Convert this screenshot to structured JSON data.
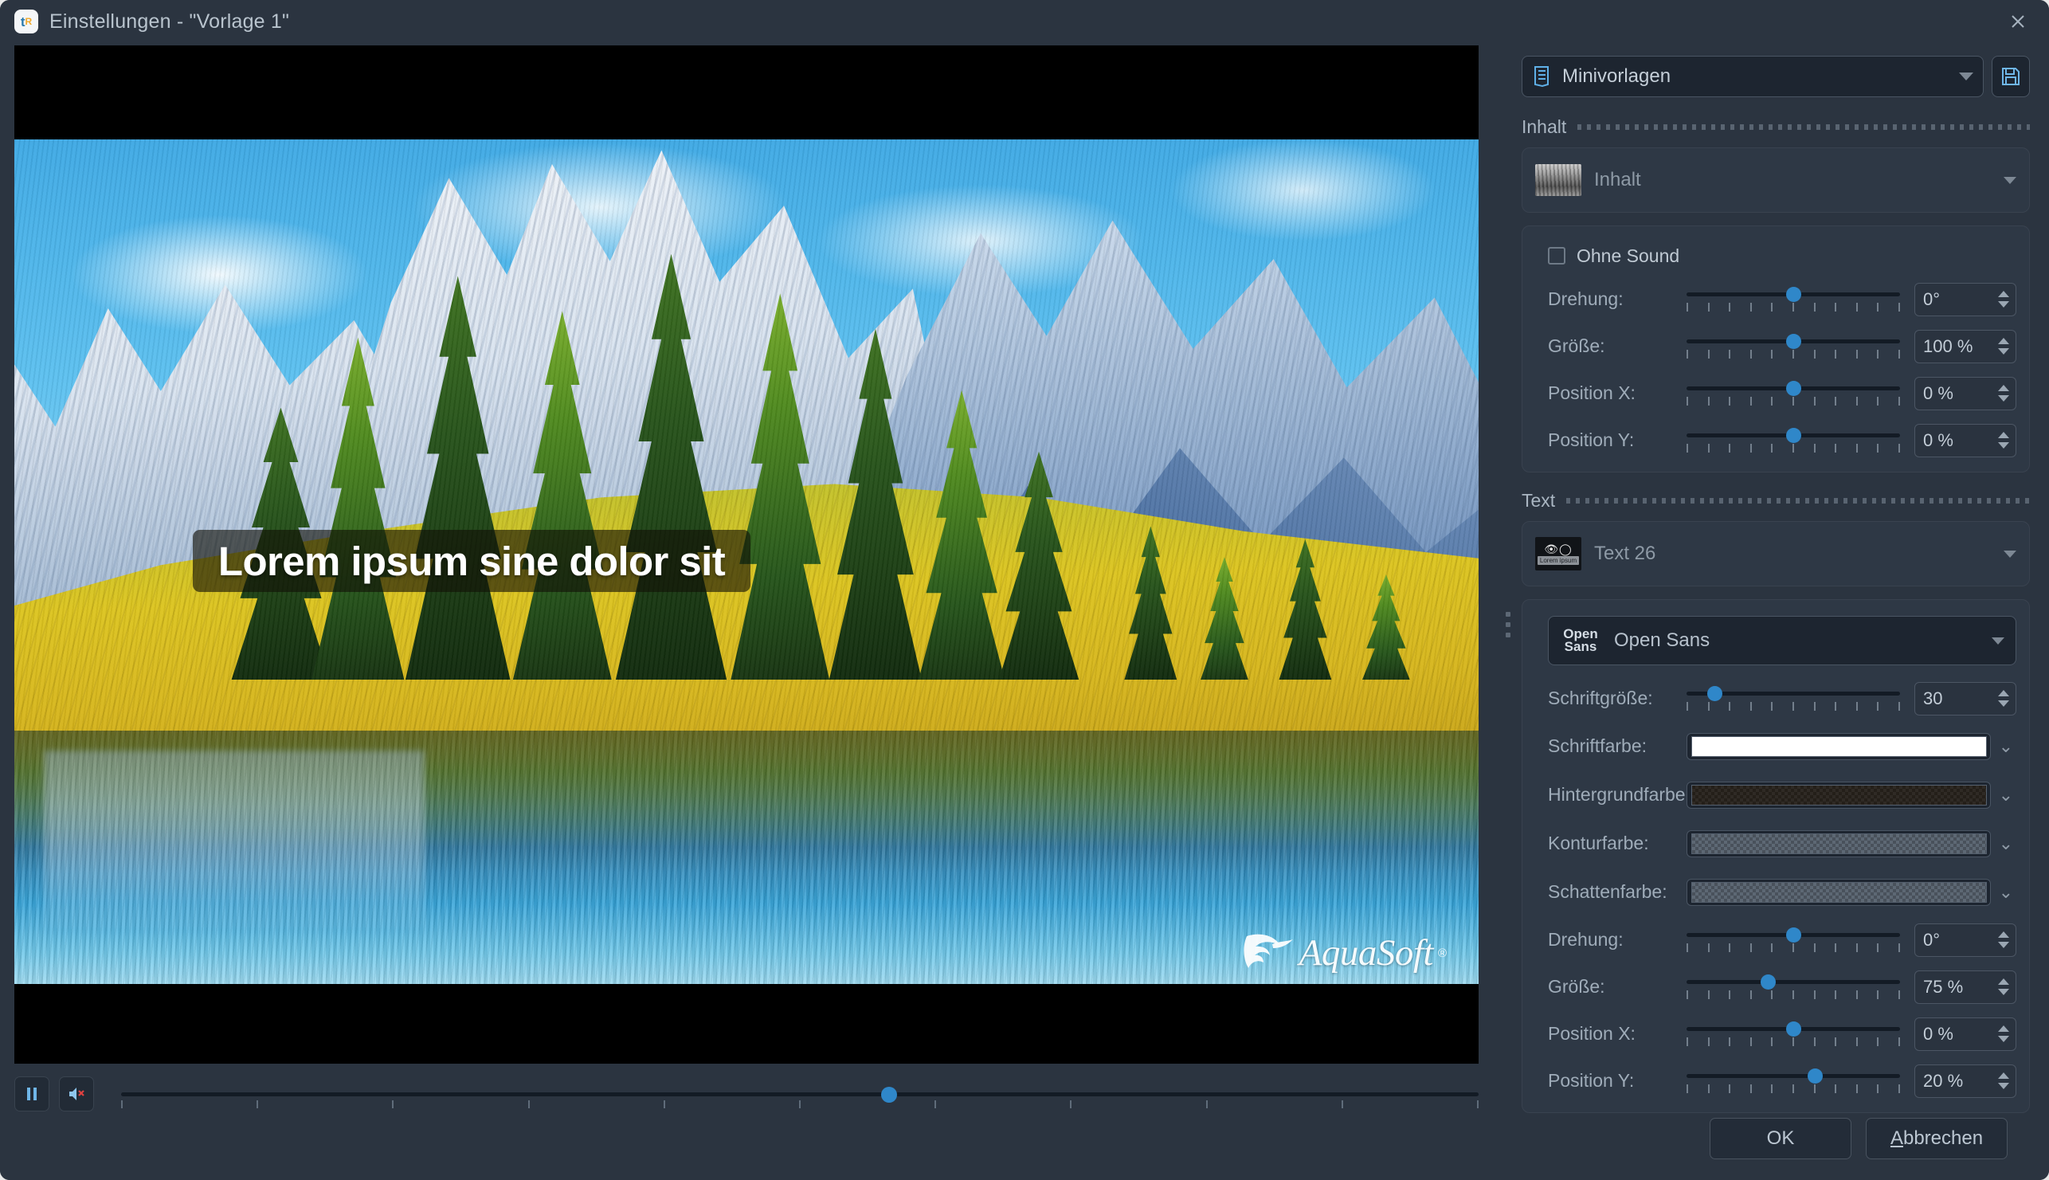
{
  "window": {
    "title": "Einstellungen - \"Vorlage 1\"",
    "app_icon": "aquasoft-app-icon",
    "close_icon": "close-icon"
  },
  "preview": {
    "overlay_text": "Lorem ipsum sine dolor sit",
    "watermark": "AquaSoft",
    "watermark_reg": "®",
    "scene_description": "mountain lake landscape"
  },
  "transport": {
    "pause_icon": "pause-icon",
    "mute_icon": "mute-speaker-icon",
    "position_percent": 56
  },
  "preset": {
    "label": "Minivorlagen",
    "icon": "template-list-icon",
    "dropdown_icon": "chevron-down-icon",
    "save_icon": "save-disk-icon"
  },
  "sections": [
    {
      "title": "Inhalt",
      "item": {
        "name": "Inhalt",
        "thumb": "landscape-thumbnail"
      },
      "checkbox": {
        "label": "Ohne Sound",
        "checked": false
      },
      "controls": [
        {
          "label": "Drehung:",
          "value": "0°",
          "pos": 50
        },
        {
          "label": "Größe:",
          "value": "100 %",
          "pos": 50
        },
        {
          "label": "Position X:",
          "value": "0 %",
          "pos": 50
        },
        {
          "label": "Position Y:",
          "value": "0 %",
          "pos": 50
        }
      ]
    },
    {
      "title": "Text",
      "item": {
        "name": "Text 26",
        "thumb": "text-layer-thumbnail",
        "thumb_caption": "Lorem ipsum",
        "thumb_icons": "eye-circle-icon"
      },
      "font": {
        "label": "Open Sans",
        "preview_line1": "Open",
        "preview_line2": "Sans"
      },
      "size": {
        "label": "Schriftgröße:",
        "value": "30",
        "pos": 13
      },
      "colors": [
        {
          "label": "Schriftfarbe:",
          "swatch": "solid-white",
          "hex": "#ffffff"
        },
        {
          "label": "Hintergrundfarbe:",
          "swatch": "check-dark",
          "hex": "#241f19"
        },
        {
          "label": "Konturfarbe:",
          "swatch": "check-gray",
          "hex": "#5d6874"
        },
        {
          "label": "Schattenfarbe:",
          "swatch": "check-gray",
          "hex": "#5d6874"
        }
      ],
      "controls": [
        {
          "label": "Drehung:",
          "value": "0°",
          "pos": 50
        },
        {
          "label": "Größe:",
          "value": "75 %",
          "pos": 38
        },
        {
          "label": "Position X:",
          "value": "0 %",
          "pos": 50
        },
        {
          "label": "Position Y:",
          "value": "20 %",
          "pos": 60
        }
      ]
    }
  ],
  "footer": {
    "ok": "OK",
    "cancel_accel": "A",
    "cancel_rest": "bbrechen"
  },
  "colors": {
    "accent": "#2f87c9",
    "panel": "#2b3440",
    "group": "#2e3845",
    "field": "#1d2530",
    "text": "#b9c4ce"
  }
}
